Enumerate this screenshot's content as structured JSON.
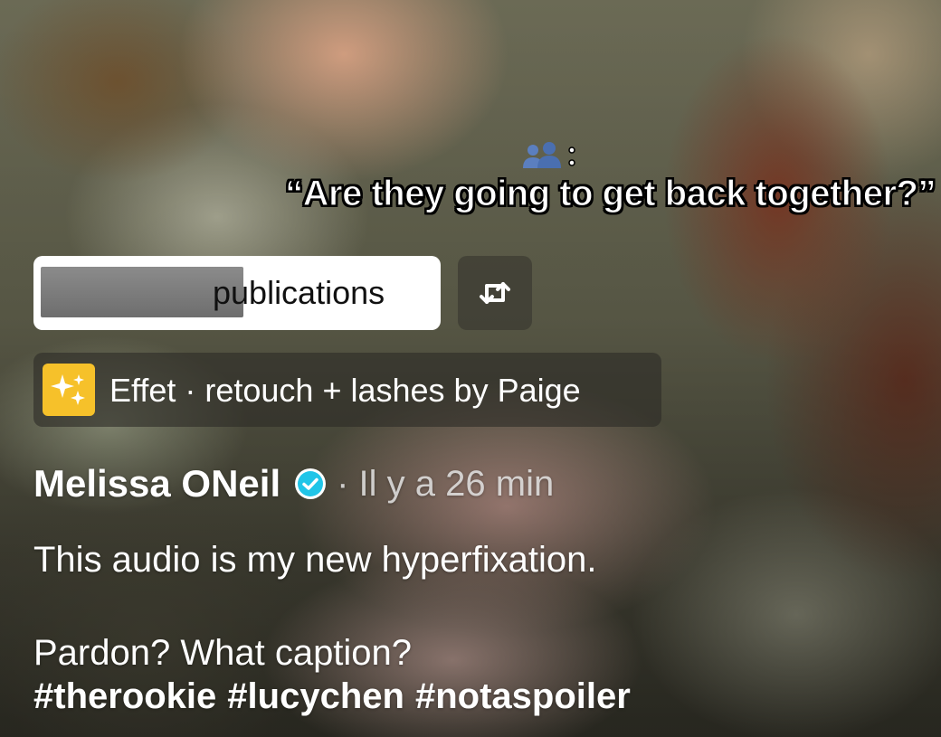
{
  "video": {
    "overlay_text": "“Are they going to get back together?”",
    "overlay_emoji_icon": "busts-in-silhouette-icon",
    "overlay_emoji_suffix": ":"
  },
  "publications": {
    "label": "publications",
    "avatar_icons": [
      "avatar",
      "avatar"
    ]
  },
  "repost": {
    "icon": "repost-icon"
  },
  "effect": {
    "icon": "sparkle-effect-icon",
    "label": "Effet · retouch + lashes by Paige"
  },
  "author": {
    "name": "Melissa ONeil",
    "verified_icon": "verified-badge-icon",
    "time": "· Il y a 26 min"
  },
  "caption": {
    "line1": "This audio is my new hyperfixation.",
    "line2": "Pardon? What caption?",
    "hashtags": [
      "#therookie",
      "#lucychen",
      "#notaspoiler"
    ]
  },
  "colors": {
    "verified": "#20c5e8",
    "effect_icon_bg": "#f6c12a",
    "pill_bg": "#ffffff"
  }
}
